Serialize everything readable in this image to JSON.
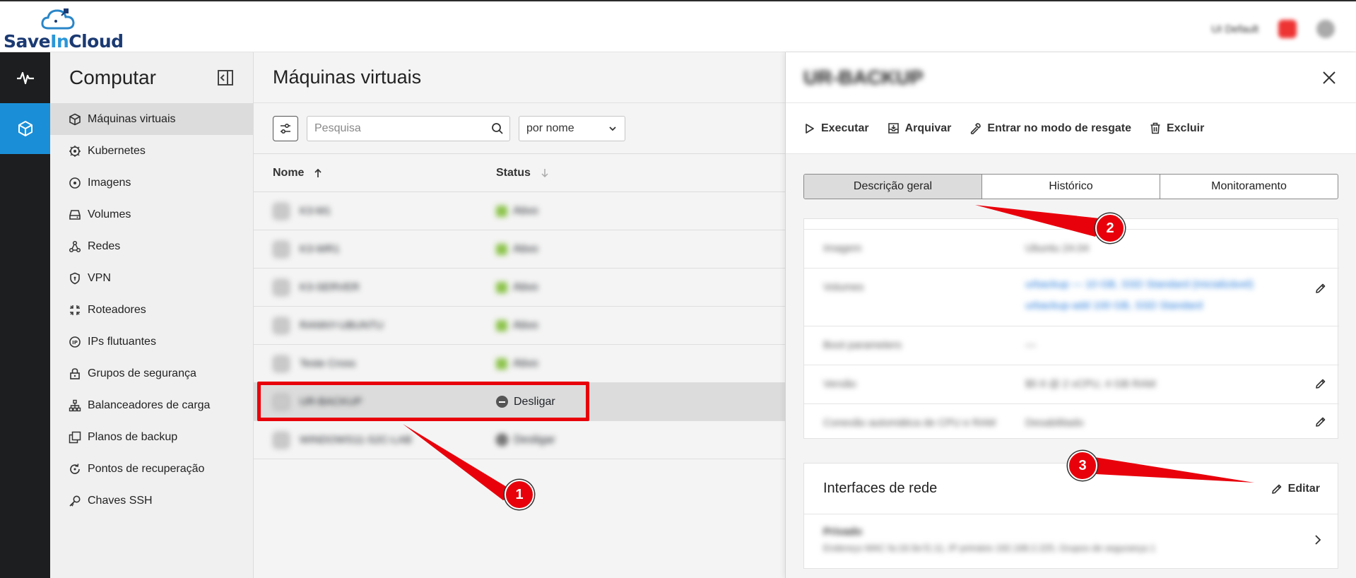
{
  "app": {
    "logo_text_a": "Save",
    "logo_text_b": "In",
    "logo_text_c": "Cloud"
  },
  "topbar": {
    "tenant": "UI Default"
  },
  "sidebar": {
    "title": "Computar",
    "items": [
      {
        "label": "Máquinas virtuais",
        "icon": "cube-icon",
        "active": true
      },
      {
        "label": "Kubernetes",
        "icon": "kubernetes-icon"
      },
      {
        "label": "Imagens",
        "icon": "disc-icon"
      },
      {
        "label": "Volumes",
        "icon": "drive-icon"
      },
      {
        "label": "Redes",
        "icon": "network-icon"
      },
      {
        "label": "VPN",
        "icon": "shield-icon"
      },
      {
        "label": "Roteadores",
        "icon": "router-icon"
      },
      {
        "label": "IPs flutuantes",
        "icon": "ip-icon"
      },
      {
        "label": "Grupos de segurança",
        "icon": "lock-icon"
      },
      {
        "label": "Balanceadores de carga",
        "icon": "loadbalancer-icon"
      },
      {
        "label": "Planos de backup",
        "icon": "copy-icon"
      },
      {
        "label": "Pontos de recuperação",
        "icon": "restore-icon"
      },
      {
        "label": "Chaves SSH",
        "icon": "key-icon"
      }
    ]
  },
  "main": {
    "title": "Máquinas virtuais",
    "search_placeholder": "Pesquisa",
    "sort_value": "por nome",
    "columns": {
      "name": "Nome",
      "status": "Status"
    },
    "rows": [
      {
        "name": "K3-M1",
        "status": "Ativo",
        "status_color": "#8bc34a"
      },
      {
        "name": "K3-WR1",
        "status": "Ativo",
        "status_color": "#8bc34a"
      },
      {
        "name": "K3-SERVER",
        "status": "Ativo",
        "status_color": "#8bc34a"
      },
      {
        "name": "RANNY-UBUNTU",
        "status": "Ativo",
        "status_color": "#8bc34a"
      },
      {
        "name": "Teste Cross",
        "status": "Ativo",
        "status_color": "#8bc34a"
      },
      {
        "name": "UR-BACKUP",
        "status": "Desligar",
        "status_color": "#555555",
        "selected": true
      },
      {
        "name": "WINDOWS11-S2C-LAB",
        "status": "Desligar",
        "status_color": "#555555"
      }
    ]
  },
  "detail": {
    "title": "UR-BACKUP",
    "actions": [
      "Executar",
      "Arquivar",
      "Entrar no modo de resgate",
      "Excluir"
    ],
    "tabs": [
      "Descrição geral",
      "Histórico",
      "Monitoramento"
    ],
    "info": [
      {
        "label": "Imagem",
        "value": "Ubuntu 24.04"
      },
      {
        "label": "Volumes",
        "value": "urbackup — 10 GB, SSD Standard (Inicializável)",
        "value2": "urbackup-add 100 GB, SSD Standard"
      },
      {
        "label": "Boot parameters",
        "value": "—"
      },
      {
        "label": "Versão",
        "value": "$5 6 @ 2 vCPU, 4 GB RAM"
      },
      {
        "label": "Conexão automática de CPU e RAM",
        "value": "Desabilitado"
      }
    ],
    "network": {
      "title": "Interfaces de rede",
      "edit_label": "Editar",
      "iface_name": "Privado",
      "iface_detail": "Endereço MAC fa:16:3e:f1:11, IP primário 192.168.2.225, Grupos de segurança 1"
    }
  },
  "annotations": {
    "badge_1": "1",
    "badge_2": "2",
    "badge_3": "3",
    "color": "#e8000b"
  }
}
